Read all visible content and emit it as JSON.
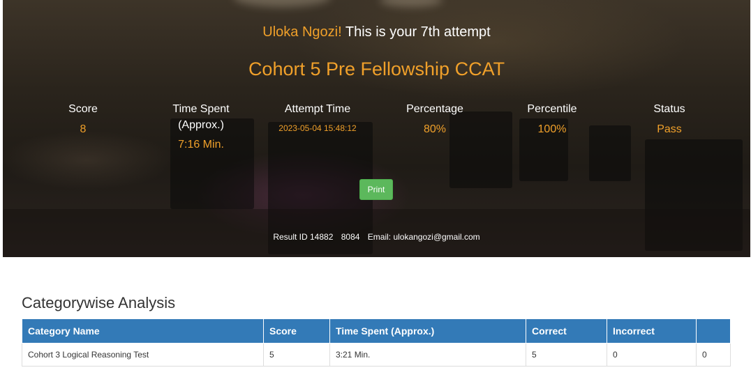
{
  "header": {
    "user_name": "Uloka Ngozi!",
    "attempt_text": "This is your 7th attempt",
    "test_title": "Cohort 5 Pre Fellowship CCAT"
  },
  "stats": {
    "score": {
      "label": "Score",
      "value": "8"
    },
    "time_spent": {
      "label": "Time Spent (Approx.)",
      "value": "7:16 Min."
    },
    "attempt_time": {
      "label": "Attempt Time",
      "value": "2023-05-04 15:48:12"
    },
    "percentage": {
      "label": "Percentage",
      "value": "80%"
    },
    "percentile": {
      "label": "Percentile",
      "value": "100%"
    },
    "status": {
      "label": "Status",
      "value": "Pass"
    }
  },
  "actions": {
    "print_label": "Print"
  },
  "result_info": {
    "result_id": "Result ID 14882",
    "code": "8084",
    "email": "Email: ulokangozi@gmail.com"
  },
  "analysis": {
    "title": "Categorywise Analysis",
    "columns": [
      "Category Name",
      "Score",
      "Time Spent (Approx.)",
      "Correct",
      "Incorrect",
      ""
    ],
    "rows": [
      [
        "Cohort 3 Logical Reasoning Test",
        "5",
        "3:21 Min.",
        "5",
        "0",
        "0"
      ]
    ]
  },
  "colors": {
    "accent": "#f0a02a",
    "table_header": "#337ab7",
    "print_button": "#5cb85c"
  }
}
